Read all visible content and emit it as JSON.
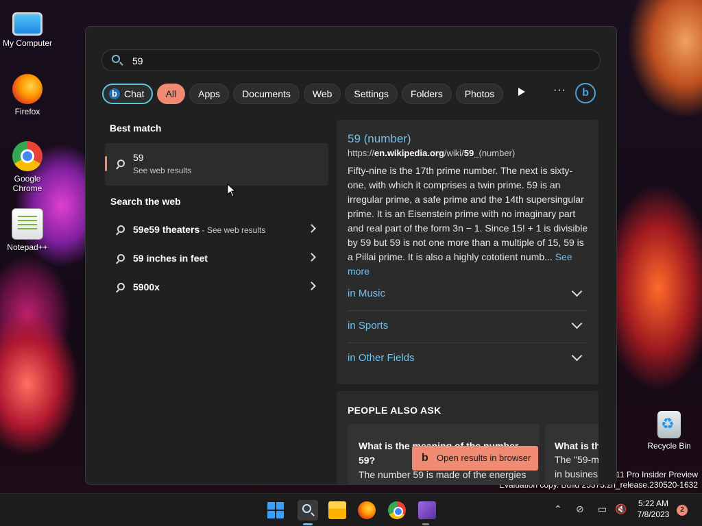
{
  "desktop": {
    "icons": [
      {
        "label": "My Computer"
      },
      {
        "label": "Firefox"
      },
      {
        "label": "Google Chrome"
      },
      {
        "label": "Notepad++"
      },
      {
        "label": "Recycle Bin"
      }
    ],
    "watermark_line1": "11 Pro Insider Preview",
    "watermark_line2": "Evaluation copy. Build 25375.zn_release.230520-1632"
  },
  "search": {
    "query": "59",
    "filters": {
      "chat": "Chat",
      "all": "All",
      "apps": "Apps",
      "documents": "Documents",
      "web": "Web",
      "settings": "Settings",
      "folders": "Folders",
      "photos": "Photos"
    },
    "more_label": "···"
  },
  "left": {
    "best_match_heading": "Best match",
    "best_match": {
      "title": "59",
      "subtitle": "See web results"
    },
    "search_web_heading": "Search the web",
    "web_results": [
      {
        "label": "59e59 theaters",
        "sub": " - See web results"
      },
      {
        "label": "59 inches in feet",
        "sub": ""
      },
      {
        "label": "5900x",
        "sub": ""
      }
    ]
  },
  "right": {
    "title": "59 (number)",
    "url_prefix": "https://",
    "url_domain": "en.wikipedia.org",
    "url_path": "/wiki/",
    "url_bold_tail": "59_",
    "url_suffix": "(number)",
    "body": "Fifty-nine is the 17th prime number. The next is sixty-one, with which it comprises a twin prime. 59 is an irregular prime, a safe prime and the 14th supersingular prime. It is an Eisenstein prime with no imaginary part and real part of the form 3n − 1. Since 15! + 1 is divisible by 59 but 59 is not one more than a multiple of 15, 59 is a Pillai prime. It is also a highly cototient numb...",
    "see_more": "See more",
    "sections": [
      {
        "label": "in Music"
      },
      {
        "label": "in Sports"
      },
      {
        "label": "in Other Fields"
      }
    ],
    "people_also_ask": {
      "heading": "PEOPLE ALSO ASK",
      "cards": [
        {
          "question": "What is the meaning of the number 59?",
          "answer": "The number 59 is made of the energies"
        },
        {
          "question": "What is th",
          "answer": "The \"59-m in busines"
        }
      ]
    }
  },
  "toast": {
    "label": "Open results in browser"
  },
  "taskbar": {
    "time": "5:22 AM",
    "date": "7/8/2023",
    "notification_count": "2",
    "tray_icons": [
      "chevron-up-icon",
      "network-off-icon",
      "display-icon",
      "volume-mute-icon"
    ]
  },
  "colors": {
    "accent": "#f08a72",
    "link": "#6fc1ef",
    "panel_bg": "#202020",
    "card_bg": "#2b2b2b"
  }
}
